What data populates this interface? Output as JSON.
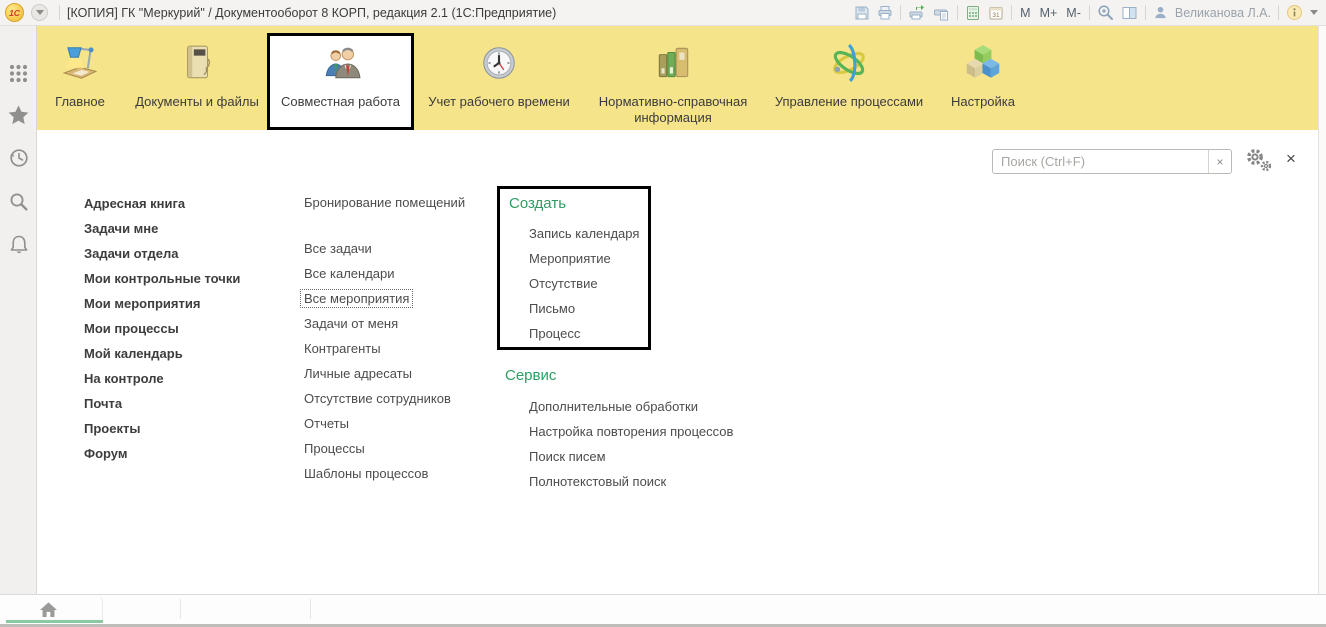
{
  "title_bar": {
    "logo_text": "1С",
    "title": "[КОПИЯ] ГК \"Меркурий\" / Документооборот 8 КОРП, редакция 2.1  (1С:Предприятие)",
    "toolbar": {
      "calendar_day": "31",
      "m": "М",
      "m_plus": "М+",
      "m_minus": "М-",
      "user_name": "Великанова Л.А."
    }
  },
  "ribbon": {
    "tabs": [
      {
        "label": "Главное",
        "active": false
      },
      {
        "label": "Документы и файлы",
        "active": false
      },
      {
        "label": "Совместная работа",
        "active": true
      },
      {
        "label": "Учет рабочего времени",
        "active": false
      },
      {
        "label": "Нормативно-справочная информация",
        "active": false
      },
      {
        "label": "Управление процессами",
        "active": false
      },
      {
        "label": "Настройка",
        "active": false
      }
    ]
  },
  "panel": {
    "search_placeholder": "Поиск (Ctrl+F)",
    "search_clear": "×",
    "close": "×"
  },
  "menu": {
    "personal": [
      "Адресная книга",
      "Задачи мне",
      "Задачи отдела",
      "Мои контрольные точки",
      "Мои мероприятия",
      "Мои процессы",
      "Мой календарь",
      "На контроле",
      "Почта",
      "Проекты",
      "Форум"
    ],
    "shared_first": [
      "Бронирование помещений"
    ],
    "shared": [
      "Все задачи",
      "Все календари",
      "Все мероприятия",
      "Задачи от меня",
      "Контрагенты",
      "Личные адресаты",
      "Отсутствие сотрудников",
      "Отчеты",
      "Процессы",
      "Шаблоны процессов"
    ],
    "focused_item": "Все мероприятия",
    "create": {
      "header": "Создать",
      "items": [
        "Запись календаря",
        "Мероприятие",
        "Отсутствие",
        "Письмо",
        "Процесс"
      ]
    },
    "service": {
      "header": "Сервис",
      "items": [
        "Дополнительные обработки",
        "Настройка повторения процессов",
        "Поиск писем",
        "Полнотекстовый поиск"
      ]
    }
  },
  "icons": {
    "titlebar": [
      "1c-logo",
      "caret-down-icon",
      "floppy-icon",
      "printer-icon",
      "printer-arrow-icon",
      "printer-page-icon",
      "calculator-icon",
      "calendar-icon",
      "magnifier-plus-icon",
      "split-panes-icon",
      "person-icon",
      "info-icon"
    ],
    "sidebar": [
      "grid-icon",
      "star-icon",
      "history-clock-icon",
      "search-icon",
      "bell-icon",
      "home-icon"
    ],
    "ribbon_tabs": [
      "desk-lamp-icon",
      "book-icon",
      "people-icon",
      "clock-icon",
      "folders-icon",
      "process-orbit-icon",
      "cubes-icon"
    ],
    "panel": [
      "clear-x-icon",
      "gears-icon",
      "close-x-icon"
    ]
  },
  "colors": {
    "ribbon_yellow": "#f5e48a",
    "accent_green": "#2f9c62",
    "taskbar_underline_green": "#8cc8a2",
    "highlight_border": "#000000"
  }
}
